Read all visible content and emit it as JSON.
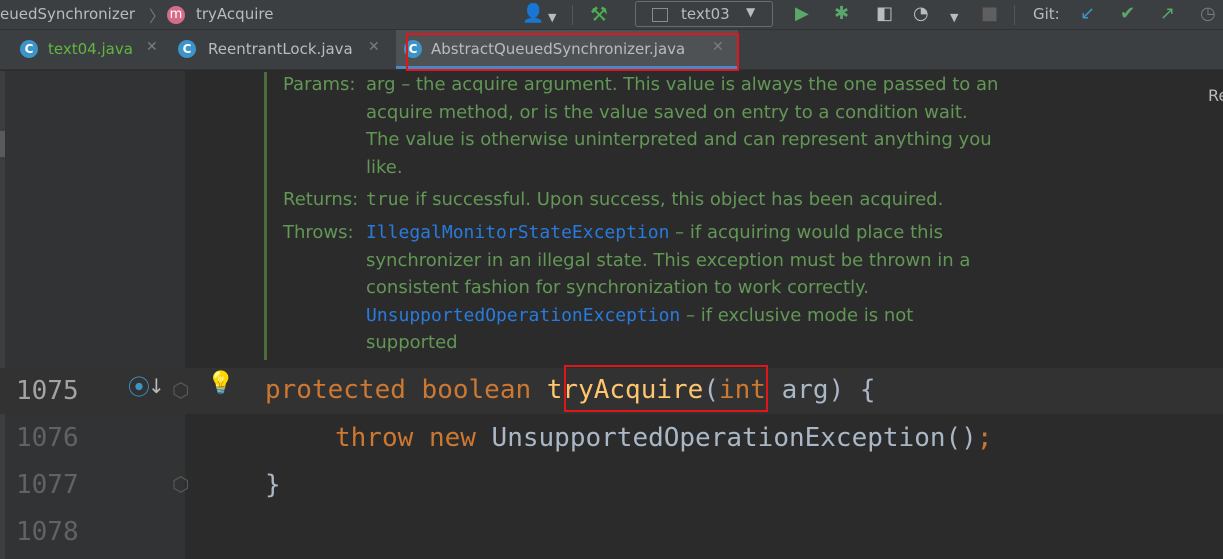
{
  "breadcrumb": {
    "class_name": "euedSynchronizer",
    "separator": "〉",
    "method_badge": "m",
    "method_name": "tryAcquire"
  },
  "toolbar": {
    "run_config": "text03",
    "git_label": "Git:",
    "icons": [
      "user-icon",
      "hammer-icon",
      "run-icon",
      "debug-icon",
      "coverage-icon",
      "profile-icon",
      "stop-icon",
      "git-update-icon",
      "git-commit-icon",
      "git-push-icon",
      "history-icon"
    ]
  },
  "tabs": [
    {
      "label": "text04.java",
      "icon": "class-icon",
      "active": false,
      "color": "#62b543"
    },
    {
      "label": "ReentrantLock.java",
      "icon": "class-icon",
      "active": false,
      "color": "#bbbbbb"
    },
    {
      "label": "AbstractQueuedSynchronizer.java",
      "icon": "class-icon",
      "active": true,
      "color": "#bbbbbb"
    }
  ],
  "doc": {
    "params_tag": "Params:",
    "params_lines": [
      "arg – the acquire argument. This value is always the one passed to an",
      "acquire method, or is the value saved on entry to a condition wait.",
      "The value is otherwise uninterpreted and can represent anything you",
      "like."
    ],
    "returns_tag": "Returns:",
    "returns_code": "true",
    "returns_text": " if successful. Upon success, this object has been acquired.",
    "throws_tag": "Throws:",
    "throws1_code": "IllegalMonitorStateException",
    "throws1_text": " – if acquiring would place this",
    "throws1_lines": [
      "synchronizer in an illegal state. This exception must be thrown in a",
      "consistent fashion for synchronization to work correctly."
    ],
    "throws2_code": "UnsupportedOperationException",
    "throws2_text": " – if exclusive mode is not",
    "throws2_line": "supported"
  },
  "code": {
    "lines": [
      {
        "number": "1075"
      },
      {
        "number": "1076"
      },
      {
        "number": "1077"
      },
      {
        "number": "1078"
      }
    ],
    "line1": {
      "kw1": "protected",
      "kw2": "boolean",
      "fn": "tryAcquire",
      "open": "(",
      "kw3": "int",
      "rest": " arg) {"
    },
    "line2": {
      "kw1": "throw",
      "kw2": "new",
      "rest": " UnsupportedOperationException()",
      "semi": ";"
    },
    "line3": {
      "rest": "}"
    }
  },
  "right_hint": "Re",
  "colors": {
    "keyword": "#cc7832",
    "function": "#ffc66d",
    "doc_comment": "#629755",
    "doc_link": "#287bde",
    "highlight_box": "#e0161b"
  }
}
